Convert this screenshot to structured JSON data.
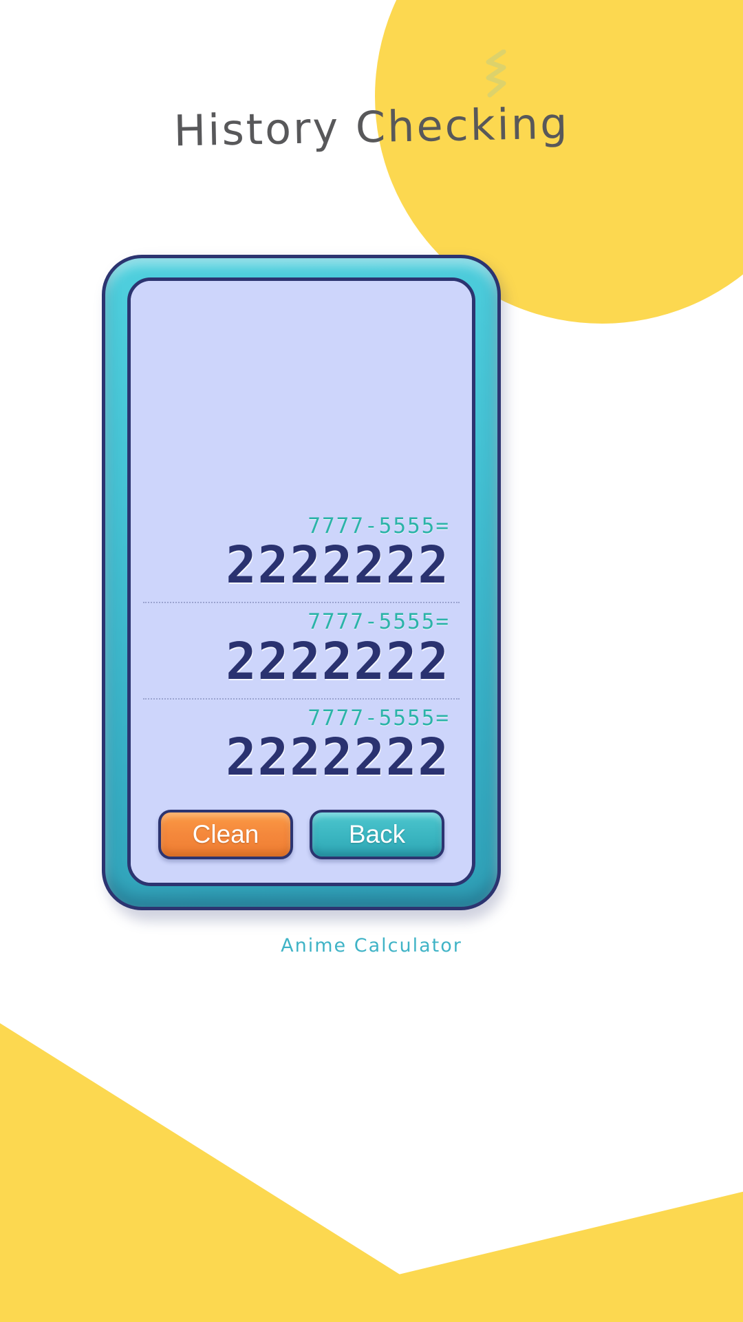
{
  "page": {
    "title": "History Checking",
    "brand": "Anime Calculator",
    "background_color": "#ffffff",
    "accent_yellow": "#fcd850",
    "accent_teal": "#3fb3c6",
    "screen_color": "#cdd5fb",
    "frame_color": "#2c3470"
  },
  "decorations": {
    "zigzag_icon": "zigzag-icon",
    "zigzag_color": "#e0d46a",
    "circle_icon": "yellow-circle-decoration",
    "wedge_icon": "yellow-wedge-decoration"
  },
  "history": {
    "entries": [
      {
        "expression": "7777-5555=",
        "result": "2222222"
      },
      {
        "expression": "7777-5555=",
        "result": "2222222"
      },
      {
        "expression": "7777-5555=",
        "result": "2222222"
      }
    ],
    "expression_color": "#2bb3a8",
    "result_color": "#2a3270"
  },
  "actions": {
    "clean_label": "Clean",
    "clean_color": "#f4873b",
    "back_label": "Back",
    "back_color": "#3bb6c1"
  }
}
